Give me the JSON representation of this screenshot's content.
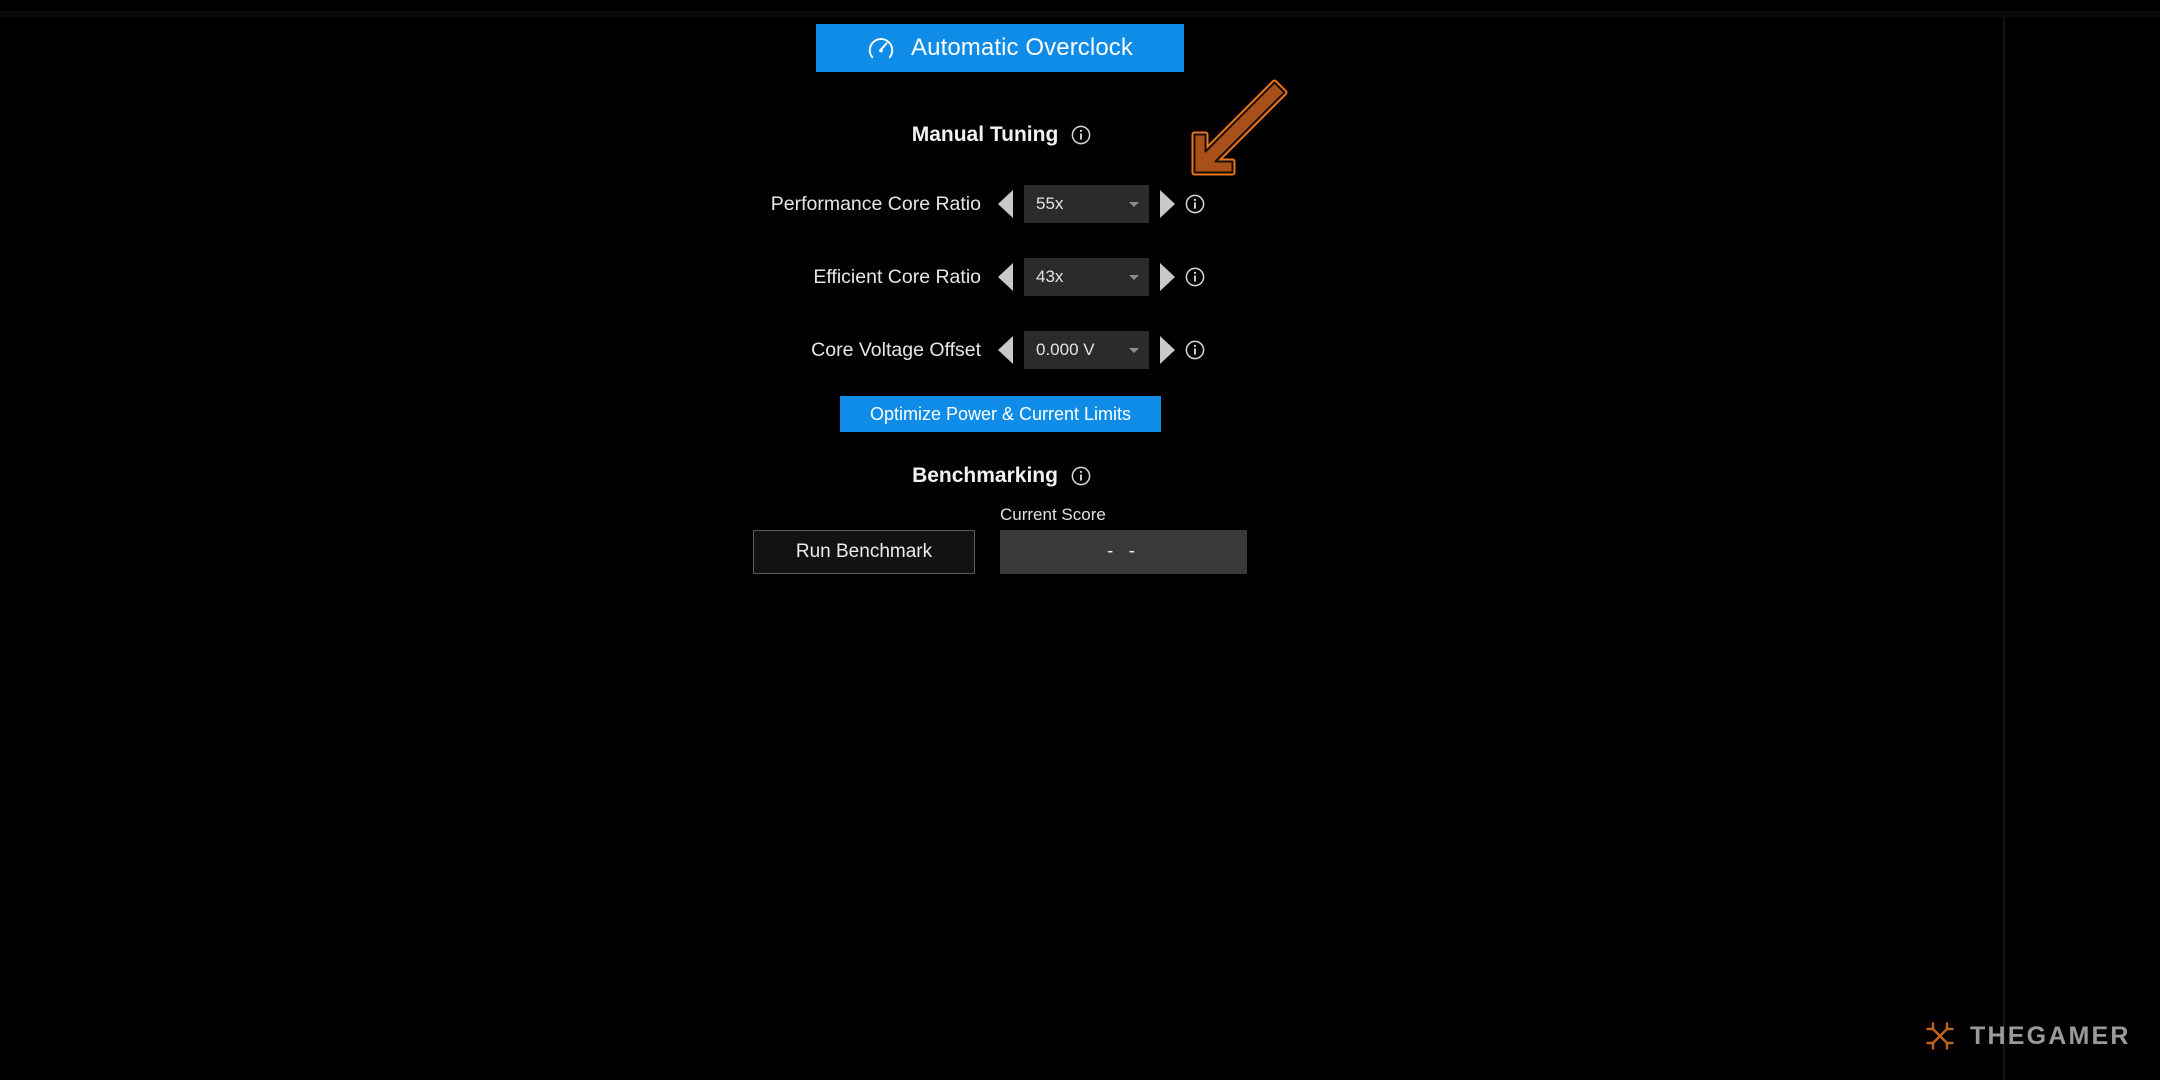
{
  "app": {
    "background_color": "#000000",
    "accent_color": "#0f8ce8",
    "annotation_color": "#e8751a"
  },
  "auto_overclock": {
    "label": "Automatic Overclock",
    "icon": "gauge-icon"
  },
  "manual_tuning": {
    "heading": "Manual Tuning",
    "info_icon": "info-icon",
    "rows": [
      {
        "label": "Performance Core Ratio",
        "value": "55x",
        "decrement_icon": "triangle-left-icon",
        "increment_icon": "triangle-right-icon",
        "info_icon": "info-icon"
      },
      {
        "label": "Efficient Core Ratio",
        "value": "43x",
        "decrement_icon": "triangle-left-icon",
        "increment_icon": "triangle-right-icon",
        "info_icon": "info-icon"
      },
      {
        "label": "Core Voltage Offset",
        "value": "0.000 V",
        "decrement_icon": "triangle-left-icon",
        "increment_icon": "triangle-right-icon",
        "info_icon": "info-icon"
      }
    ],
    "optimize_label": "Optimize Power & Current Limits"
  },
  "benchmarking": {
    "heading": "Benchmarking",
    "info_icon": "info-icon",
    "run_label": "Run Benchmark",
    "score_label": "Current Score",
    "score_value": "- -"
  },
  "annotation": {
    "type": "arrow",
    "direction": "down-left",
    "points_at": "Performance Core Ratio increment arrow",
    "outline_color": "#e8751a",
    "fill_color": "#a85018"
  },
  "watermark": {
    "text": "THEGAMER",
    "mark_icon": "thegamer-logo-icon"
  }
}
